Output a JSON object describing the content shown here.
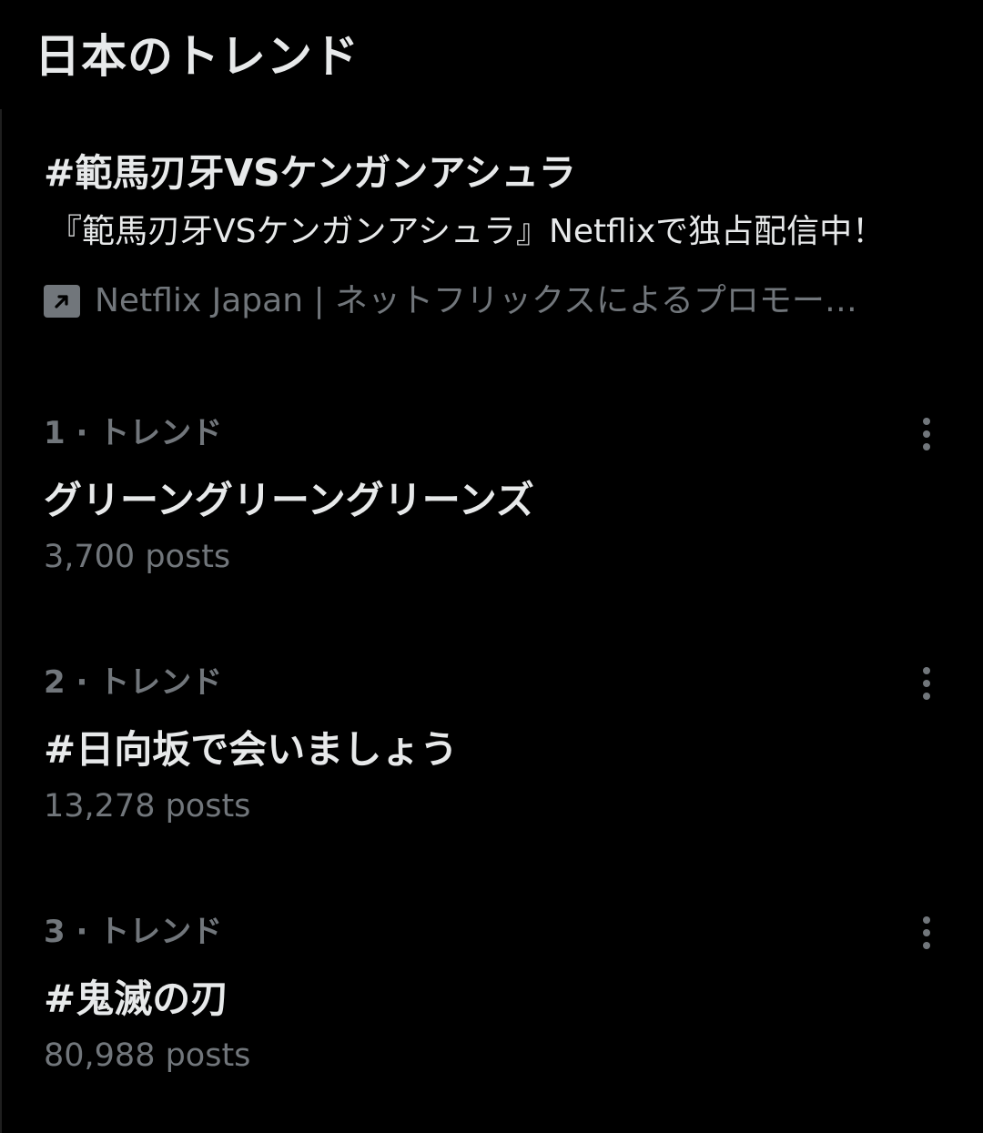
{
  "header": {
    "title": "日本のトレンド"
  },
  "promoted": {
    "title": "#範馬刃牙VSケンガンアシュラ",
    "description": "『範馬刃牙VSケンガンアシュラ』Netflixで独占配信中！",
    "promoted_by": "Netflix Japan | ネットフリックスによるプロモー…",
    "icon": "promoted-arrow-icon"
  },
  "trends": [
    {
      "meta": "1 · トレンド",
      "name": "グリーングリーングリーンズ",
      "count": "3,700 posts"
    },
    {
      "meta": "2 · トレンド",
      "name": "#日向坂で会いましょう",
      "count": "13,278 posts"
    },
    {
      "meta": "3 · トレンド",
      "name": "#鬼滅の刃",
      "count": "80,988 posts"
    }
  ],
  "colors": {
    "background": "#000000",
    "primary_text": "#e7e9ea",
    "secondary_text": "#71767b"
  }
}
